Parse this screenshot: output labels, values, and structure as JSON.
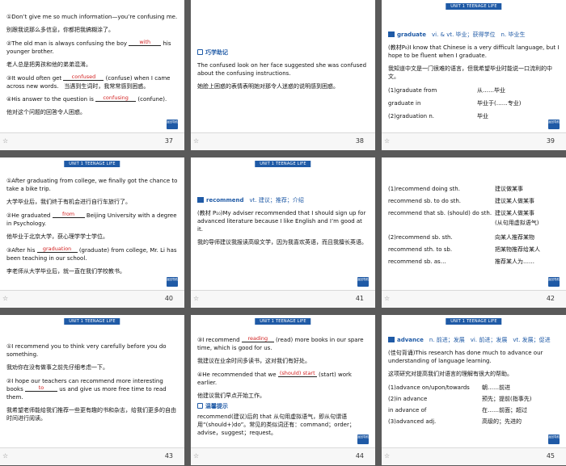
{
  "header": "UNIT 1   TEENAGE LIFE",
  "nav_label": "返回导航",
  "slides": [
    {
      "num": "37",
      "s1_pre": "①Don’t give me so much information—you’re confusing me.",
      "s1_cn": "别跟我说那么多信息，你都把我搞糊涂了。",
      "s2_pre": "②The old man is always confusing the boy",
      "s2_ans": "with",
      "s2_post": "his younger brother.",
      "s2_cn": "老人总是把男孩和他的弟弟混淆。",
      "s3_pre": "③It would often get",
      "s3_ans": "confused",
      "s3_post": "(confuse) when I came across new words.　当遇到生词时，我常常感到困惑。",
      "s4_pre": "④His answer to the question is",
      "s4_ans": "confusing",
      "s4_post": "(confune).",
      "s4_cn": "他对这个问题的回答令人困惑。"
    },
    {
      "num": "38",
      "tip_title": "巧学助记",
      "en": "The confused look on her face suggested she was confused about the confusing instructions.",
      "cn": "她脸上困惑的表情表明她对那令人迷惑的说明感到困惑。"
    },
    {
      "num": "39",
      "word": "graduate",
      "def": "vi. & vt. 毕业；获得学位　n. 毕业生",
      "ex_en": "(教材P₈)I know that Chinese is a very difficult language, but I hope to be fluent when I graduate.",
      "ex_cn": "我知道中文是一门很难的语言，但我希望毕业时能说一口流利的中文。",
      "p1": "(1)graduate from",
      "p1cn": "从……毕业",
      "p2": "graduate in",
      "p2cn": "毕业于(……专业)",
      "p3": "(2)graduation n.",
      "p3cn": "毕业"
    },
    {
      "num": "40",
      "s1": "①After graduating from college, we finally got the chance to take a bike trip.",
      "s1cn": "大学毕业后，我们终于有机会进行自行车旅行了。",
      "s2_pre": "②He graduated",
      "s2_ans": "from",
      "s2_post": "Beijing University with a degree in Psychology.",
      "s2cn": "他毕业于北京大学，获心理学学士学位。",
      "s3_pre": "③After his",
      "s3_ans": "graduation",
      "s3_post": "(graduate) from college, Mr. Li has been teaching in our school.",
      "s3cn": "李老师从大学毕业后，就一直在我们学校教书。"
    },
    {
      "num": "41",
      "word": "recommend",
      "def": "vt. 建议；推荐；介绍",
      "ex_en": "(教材 P₁₀)My adviser recommended that I should sign up for advanced literature because I like English and I’m good at it.",
      "ex_cn": "我的导师建议我报读高级文学，因为我喜欢英语，而且我擅长英语。"
    },
    {
      "num": "42",
      "rows": [
        [
          "(1)recommend doing sth.",
          "建议做某事"
        ],
        [
          "recommend sb. to do sth.",
          "建议某人做某事"
        ],
        [
          "recommend that sb. (should) do sth.",
          "建议某人做某事"
        ],
        [
          "",
          "(从句用虚拟语气)"
        ],
        [
          "(2)recommend sb. sth.",
          "向某人推荐某物"
        ],
        [
          "recommend sth. to sb.",
          "把某物推荐给某人"
        ],
        [
          "recommend sb. as…",
          "推荐某人为……"
        ]
      ]
    },
    {
      "num": "43",
      "s1": "①I recommend you to think very carefully before you do something.",
      "s1cn": "我劝你在没有做事之前先仔细考虑一下。",
      "s2_pre": "②I hope our teachers can recommend more interesting books",
      "s2_ans": "to",
      "s2_post": "us and give us more free time to read them.",
      "s2cn": "我希望老师能给我们推荐一些更有趣的书和杂志，给我们更多的自由时间进行阅读。"
    },
    {
      "num": "44",
      "s3_pre": "③I recommend",
      "s3_ans": "reading",
      "s3_post": "(read) more books in our spare time, which is good for us.",
      "s3cn": "我建议在业余时间多读书，这对我们有好处。",
      "s4_pre": "④He recommended that we",
      "s4_ans": "(should) start",
      "s4_post": "(start) work earlier.",
      "s4cn": "他建议我们早点开始工作。",
      "tip_title": "温馨提示",
      "tip": "recommend(建议)后的 that 从句用虚拟语气，即从句谓语用“(should+)do”。常见的类似词还有：command；order；advise，suggest；request。"
    },
    {
      "num": "45",
      "word": "advance",
      "def": "n. 前进；发展　vi. 前进；发展　vt. 发展；促进",
      "ex_en": "(佳句背诵)This research has done much to advance our understanding of language learning.",
      "ex_cn": "这项研究对提高我们对语言的理解有很大的帮助。",
      "p1": "(1)advance on/upon/towards",
      "p1cn": "朝……前进",
      "p2": "(2)in advance",
      "p2cn": "预先；提前(指事先)",
      "p3": "in advance of",
      "p3cn": "在……前面；超过",
      "p4": "(3)advanced adj.",
      "p4cn": "高级的；先进的"
    }
  ]
}
